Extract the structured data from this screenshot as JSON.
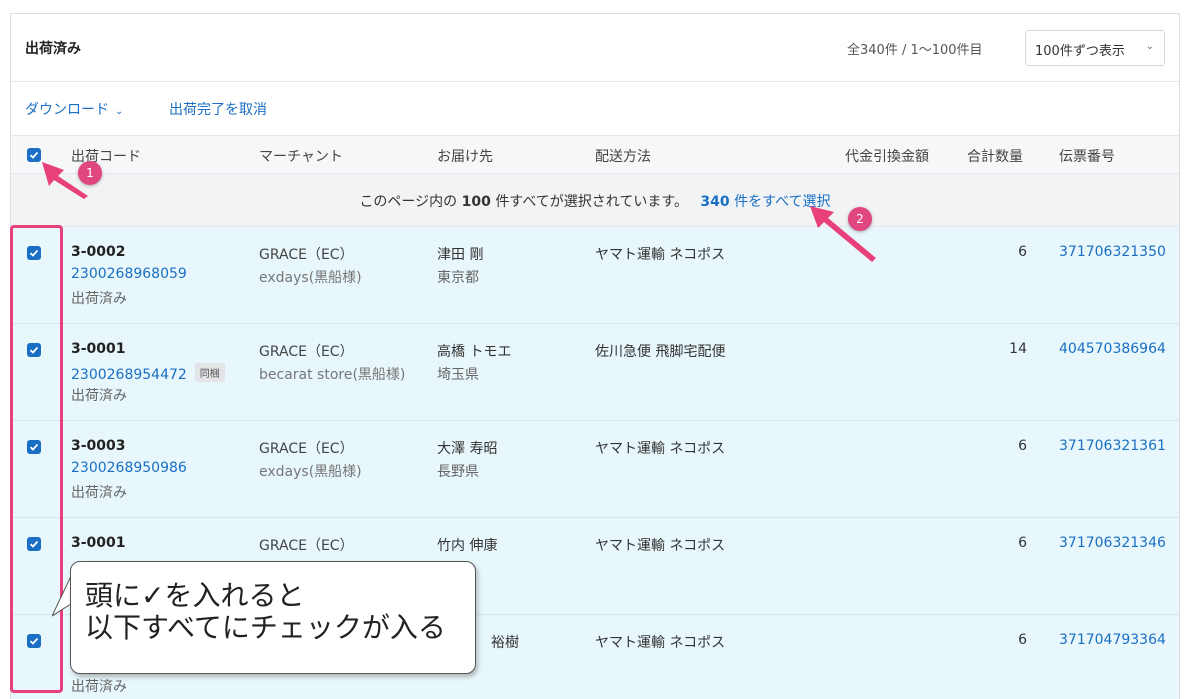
{
  "header": {
    "title": "出荷済み",
    "count": "全340件 / 1〜100件目",
    "per_page": "100件ずつ表示"
  },
  "toolbar": {
    "download": "ダウンロード",
    "cancel_shipment": "出荷完了を取消"
  },
  "columns": {
    "code": "出荷コード",
    "merchant": "マーチャント",
    "destination": "お届け先",
    "method": "配送方法",
    "cod": "代金引換金額",
    "qty": "合計数量",
    "tracking": "伝票番号"
  },
  "select_bar": {
    "prefix": "このページ内の",
    "count": "100",
    "suffix": "件すべてが選択されています。",
    "select_all_count": "340",
    "select_all_suffix": "件をすべて選択"
  },
  "rows": [
    {
      "code": "3-0002",
      "subcode": "2300268968059",
      "tag": "",
      "status": "出荷済み",
      "merchant": "GRACE（EC）",
      "merchant_sub": "exdays(黒船様)",
      "dest": "津田 剛",
      "dest_sub": "東京都",
      "method": "ヤマト運輸 ネコポス",
      "qty": "6",
      "tracking": "371706321350"
    },
    {
      "code": "3-0001",
      "subcode": "2300268954472",
      "tag": "同梱",
      "status": "出荷済み",
      "merchant": "GRACE（EC）",
      "merchant_sub": "becarat store(黒船様)",
      "dest": "高橋 トモエ",
      "dest_sub": "埼玉県",
      "method": "佐川急便 飛脚宅配便",
      "qty": "14",
      "tracking": "404570386964"
    },
    {
      "code": "3-0003",
      "subcode": "2300268950986",
      "tag": "",
      "status": "出荷済み",
      "merchant": "GRACE（EC）",
      "merchant_sub": "exdays(黒船様)",
      "dest": "大澤 寿昭",
      "dest_sub": "長野県",
      "method": "ヤマト運輸 ネコポス",
      "qty": "6",
      "tracking": "371706321361"
    },
    {
      "code": "3-0001",
      "subcode": "",
      "tag": "",
      "status": "",
      "merchant": "GRACE（EC）",
      "merchant_sub": "",
      "dest": "竹内 伸康",
      "dest_sub": "",
      "method": "ヤマト運輸 ネコポス",
      "qty": "6",
      "tracking": "371706321346"
    },
    {
      "code": "",
      "subcode": "",
      "tag": "",
      "status": "出荷済み",
      "merchant": "",
      "merchant_sub": "",
      "dest": "裕樹",
      "dest_sub": "",
      "method": "ヤマト運輸 ネコポス",
      "qty": "6",
      "tracking": "371704793364"
    }
  ],
  "annotations": {
    "badge_1": "1",
    "badge_2": "2",
    "callout_line1": "頭に✓を入れると",
    "callout_line2": "以下すべてにチェックが入る"
  },
  "colors": {
    "accent": "#1a6fc4",
    "row_selected": "#e8f7fb",
    "annotation": "#e8407a"
  }
}
